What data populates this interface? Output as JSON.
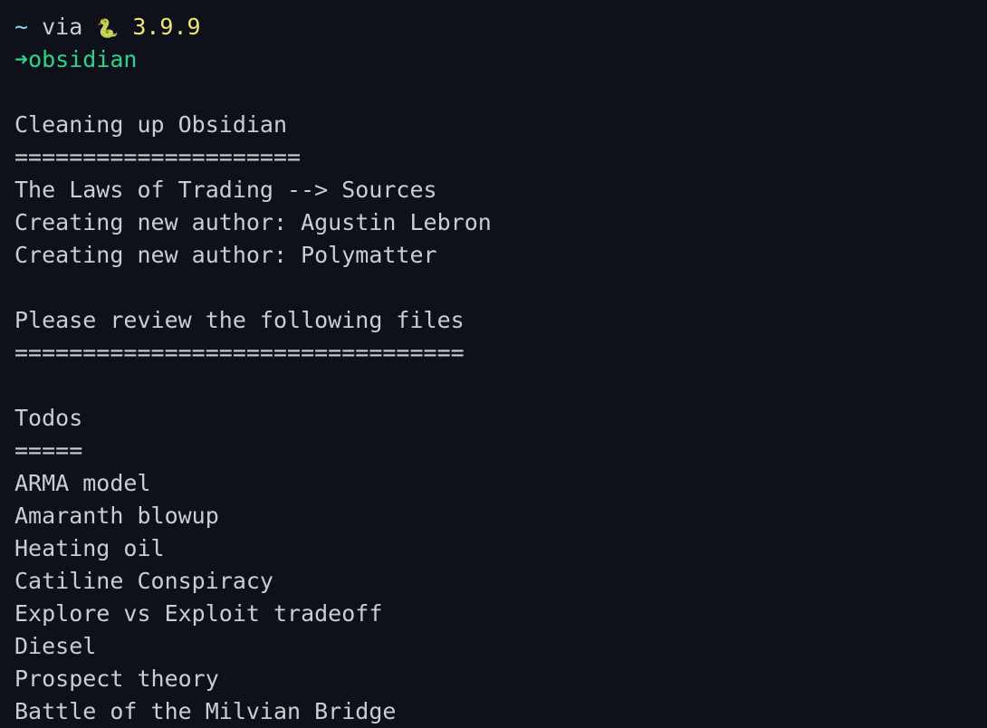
{
  "prompt": {
    "tilde": "~",
    "via": "via",
    "snake_icon": "🐍",
    "python_version": "3.9.9",
    "arrow_icon": "➜",
    "directory": "obsidian"
  },
  "output": {
    "cleanup_header": "Cleaning up Obsidian",
    "cleanup_rule": "=====================",
    "cleanup_lines": [
      "The Laws of Trading --> Sources",
      "Creating new author: Agustin Lebron",
      "Creating new author: Polymatter"
    ],
    "review_header": "Please review the following files",
    "review_rule": "=================================",
    "todos_header": "Todos",
    "todos_rule": "=====",
    "todos": [
      "ARMA model",
      "Amaranth blowup",
      "Heating oil",
      "Catiline Conspiracy",
      "Explore vs Exploit tradeoff",
      "Diesel",
      "Prospect theory",
      "Battle of the Milvian Bridge"
    ]
  },
  "colors": {
    "background": "#0f111a",
    "text": "#c9cdd6",
    "tilde": "#89d8ee",
    "version": "#eee47a",
    "prompt_green": "#2fd28a"
  }
}
